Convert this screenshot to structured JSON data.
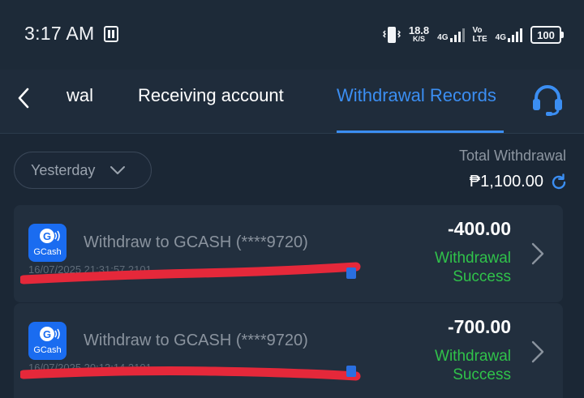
{
  "status_bar": {
    "time": "3:17 AM",
    "speed_value": "18.8",
    "speed_unit": "K/S",
    "sim1_tag": "4G",
    "volte_top": "Vo",
    "volte_bottom": "LTE",
    "sim2_tag": "4G",
    "battery": "100"
  },
  "tabs": [
    {
      "label": "wal"
    },
    {
      "label": "Receiving account"
    },
    {
      "label": "Withdrawal Records",
      "active": true
    }
  ],
  "filter": {
    "date_label": "Yesterday"
  },
  "summary": {
    "total_label": "Total Withdrawal",
    "total_amount": "₱1,100.00"
  },
  "records": [
    {
      "title": "Withdraw to GCASH (****9720)",
      "subtitle": "16/07/2025 21:31:57  2101",
      "amount": "-400.00",
      "status_line1": "Withdrawal",
      "status_line2": "Success",
      "logo_text": "GCash"
    },
    {
      "title": "Withdraw to GCASH (****9720)",
      "subtitle": "16/07/2025 20:13:14  2101",
      "amount": "-700.00",
      "status_line1": "Withdrawal",
      "status_line2": "Success",
      "logo_text": "GCash"
    }
  ],
  "colors": {
    "accent": "#3b8ef2",
    "success": "#30c24a",
    "background": "#1b2735",
    "card": "#222f3e",
    "redaction": "#e5283a"
  },
  "icons": [
    "back-arrow-icon",
    "headset-icon",
    "chevron-down-icon",
    "refresh-icon",
    "gcash-icon",
    "copy-icon",
    "chevron-right-icon"
  ]
}
